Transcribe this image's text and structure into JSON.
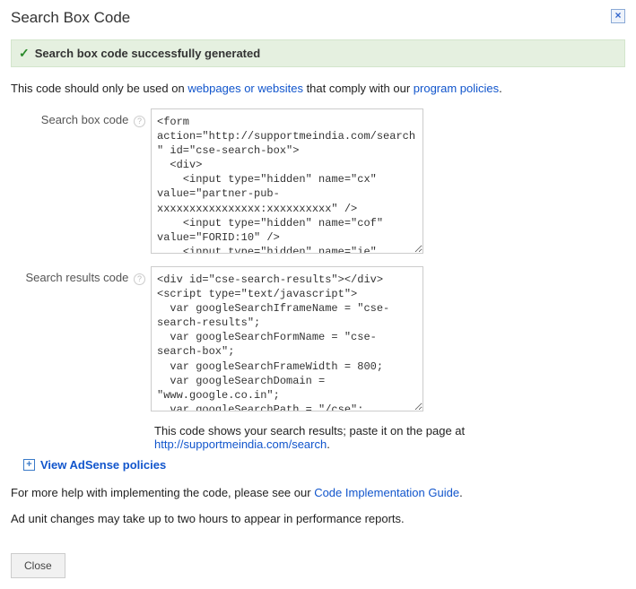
{
  "dialog": {
    "title": "Search Box Code",
    "close_x": "×"
  },
  "success": {
    "icon": "✓",
    "text": "Search box code successfully generated"
  },
  "desc": {
    "before": "This code should only be used on ",
    "link1": "webpages or websites",
    "mid": " that comply with our ",
    "link2": "program policies",
    "after": "."
  },
  "fields": {
    "box": {
      "label": "Search box code",
      "code": "<form action=\"http://supportmeindia.com/search\" id=\"cse-search-box\">\n  <div>\n    <input type=\"hidden\" name=\"cx\" value=\"partner-pub-xxxxxxxxxxxxxxxx:xxxxxxxxxx\" />\n    <input type=\"hidden\" name=\"cof\" value=\"FORID:10\" />\n    <input type=\"hidden\" name=\"ie\""
    },
    "results": {
      "label": "Search results code",
      "code": "<div id=\"cse-search-results\"></div>\n<script type=\"text/javascript\">\n  var googleSearchIframeName = \"cse-search-results\";\n  var googleSearchFormName = \"cse-search-box\";\n  var googleSearchFrameWidth = 800;\n  var googleSearchDomain = \"www.google.co.in\";\n  var googleSearchPath = \"/cse\";"
    }
  },
  "results_para": {
    "before": "This code shows your search results; paste it on the page at ",
    "link": "http://supportmeindia.com/search",
    "after": "."
  },
  "expand": {
    "label": "View AdSense policies"
  },
  "help": {
    "before": "For more help with implementing the code, please see our ",
    "link": "Code Implementation Guide",
    "after": "."
  },
  "note": "Ad unit changes may take up to two hours to appear in performance reports.",
  "buttons": {
    "close": "Close"
  }
}
